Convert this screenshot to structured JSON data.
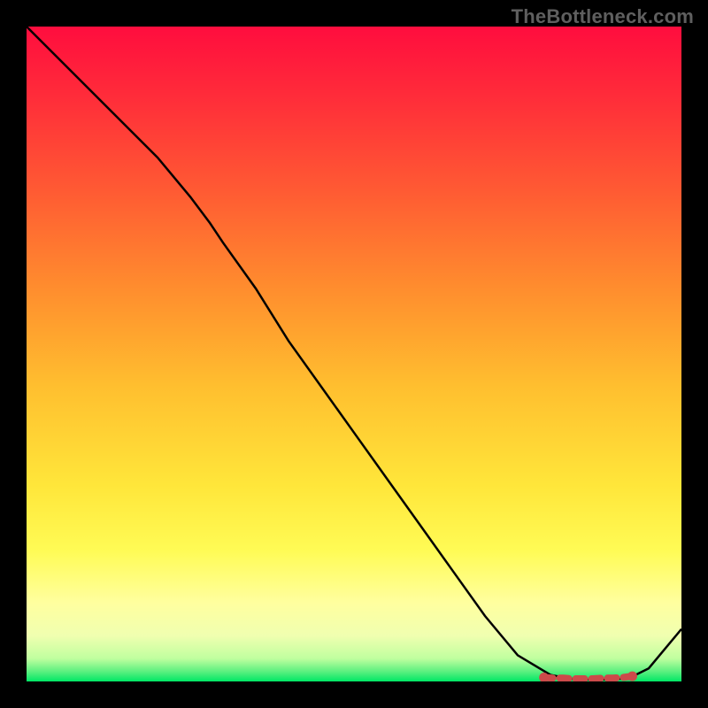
{
  "watermark": "TheBottleneck.com",
  "chart_data": {
    "type": "line",
    "title": "",
    "xlabel": "",
    "ylabel": "",
    "xlim": [
      0,
      100
    ],
    "ylim": [
      0,
      100
    ],
    "grid": false,
    "legend": false,
    "series": [
      {
        "name": "curve",
        "color": "#000000",
        "x": [
          0,
          5,
          10,
          15,
          20,
          25,
          28,
          30,
          35,
          40,
          45,
          50,
          55,
          60,
          65,
          70,
          75,
          80,
          83,
          86,
          89,
          92,
          95,
          100
        ],
        "y": [
          100,
          95,
          90,
          85,
          80,
          74,
          70,
          67,
          60,
          52,
          45,
          38,
          31,
          24,
          17,
          10,
          4,
          1,
          0.4,
          0.3,
          0.3,
          0.5,
          2,
          8
        ]
      },
      {
        "name": "optimal-marker",
        "color": "#cc4a4a",
        "type": "scatter",
        "x": [
          79,
          80.5,
          82,
          83.5,
          85,
          86.5,
          88,
          89.5,
          91,
          92.5
        ],
        "y": [
          0.6,
          0.5,
          0.5,
          0.4,
          0.4,
          0.4,
          0.5,
          0.5,
          0.6,
          0.8
        ]
      }
    ],
    "background_gradient": {
      "stops": [
        {
          "offset": 0.0,
          "color": "#ff0d3e"
        },
        {
          "offset": 0.1,
          "color": "#ff2a3a"
        },
        {
          "offset": 0.25,
          "color": "#ff5a33"
        },
        {
          "offset": 0.4,
          "color": "#ff8d2e"
        },
        {
          "offset": 0.55,
          "color": "#ffbf2f"
        },
        {
          "offset": 0.7,
          "color": "#ffe63a"
        },
        {
          "offset": 0.8,
          "color": "#fffb55"
        },
        {
          "offset": 0.88,
          "color": "#ffff9f"
        },
        {
          "offset": 0.93,
          "color": "#f0ffb0"
        },
        {
          "offset": 0.965,
          "color": "#c0ff9f"
        },
        {
          "offset": 0.985,
          "color": "#5af07f"
        },
        {
          "offset": 1.0,
          "color": "#00e765"
        }
      ]
    }
  }
}
